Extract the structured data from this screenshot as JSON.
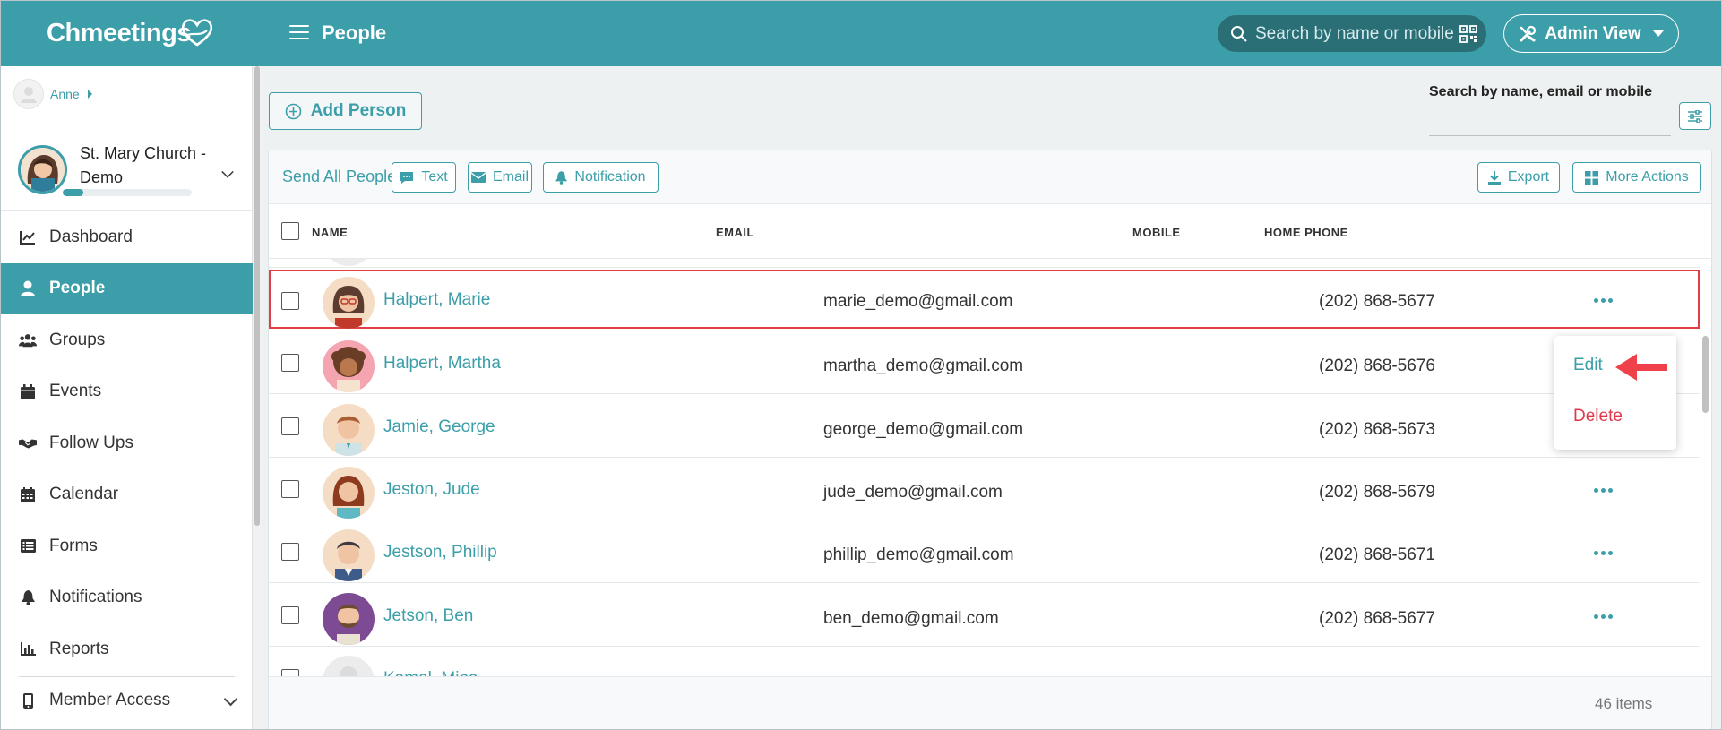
{
  "app": {
    "logo_text": "Chmeetings",
    "page_title": "People"
  },
  "topbar": {
    "search_placeholder": "Search by name or mobile",
    "admin_view_label": "Admin View"
  },
  "sidebar": {
    "user_name": "Anne",
    "church_name": "St. Mary Church - Demo",
    "church_progress_fraction": 0.16,
    "items": [
      {
        "label": "Dashboard",
        "icon": "chart-line-icon",
        "active": false
      },
      {
        "label": "People",
        "icon": "person-icon",
        "active": true
      },
      {
        "label": "Groups",
        "icon": "users-icon",
        "active": false
      },
      {
        "label": "Events",
        "icon": "calendar-icon",
        "active": false
      },
      {
        "label": "Follow Ups",
        "icon": "handshake-icon",
        "active": false
      },
      {
        "label": "Calendar",
        "icon": "calendar-grid-icon",
        "active": false
      },
      {
        "label": "Forms",
        "icon": "list-icon",
        "active": false
      },
      {
        "label": "Notifications",
        "icon": "bell-icon",
        "active": false
      },
      {
        "label": "Reports",
        "icon": "bar-chart-icon",
        "active": false
      }
    ],
    "member_access_label": "Member Access"
  },
  "main": {
    "add_person_label": "Add Person",
    "search_label": "Search by name, email or mobile",
    "search_value": "",
    "toolbar": {
      "send_all_label": "Send All People:",
      "text_label": "Text",
      "email_label": "Email",
      "notification_label": "Notification",
      "export_label": "Export",
      "more_actions_label": "More Actions"
    },
    "table": {
      "columns": [
        "NAME",
        "EMAIL",
        "MOBILE",
        "HOME PHONE"
      ],
      "rows": [
        {
          "name": "Halpert, Marie",
          "email": "marie_demo@gmail.com",
          "mobile": "(202) 868-5677",
          "home_phone": "",
          "highlighted": true
        },
        {
          "name": "Halpert, Martha",
          "email": "martha_demo@gmail.com",
          "mobile": "(202) 868-5676",
          "home_phone": "",
          "highlighted": false
        },
        {
          "name": "Jamie, George",
          "email": "george_demo@gmail.com",
          "mobile": "(202) 868-5673",
          "home_phone": "",
          "highlighted": false
        },
        {
          "name": "Jeston, Jude",
          "email": "jude_demo@gmail.com",
          "mobile": "(202) 868-5679",
          "home_phone": "",
          "highlighted": false
        },
        {
          "name": "Jestson, Phillip",
          "email": "phillip_demo@gmail.com",
          "mobile": "(202) 868-5671",
          "home_phone": "",
          "highlighted": false
        },
        {
          "name": "Jetson, Ben",
          "email": "ben_demo@gmail.com",
          "mobile": "(202) 868-5677",
          "home_phone": "",
          "highlighted": false
        },
        {
          "name": "Kamal, Mina",
          "email": "",
          "mobile": "",
          "home_phone": "",
          "highlighted": false
        }
      ],
      "items_count": "46 items"
    },
    "context_menu": {
      "edit_label": "Edit",
      "delete_label": "Delete"
    }
  },
  "colors": {
    "brand_teal": "#3b9ea9",
    "highlight_red": "#e53d48",
    "delete_red": "#e0384b",
    "arrow_red": "#f0414a"
  }
}
